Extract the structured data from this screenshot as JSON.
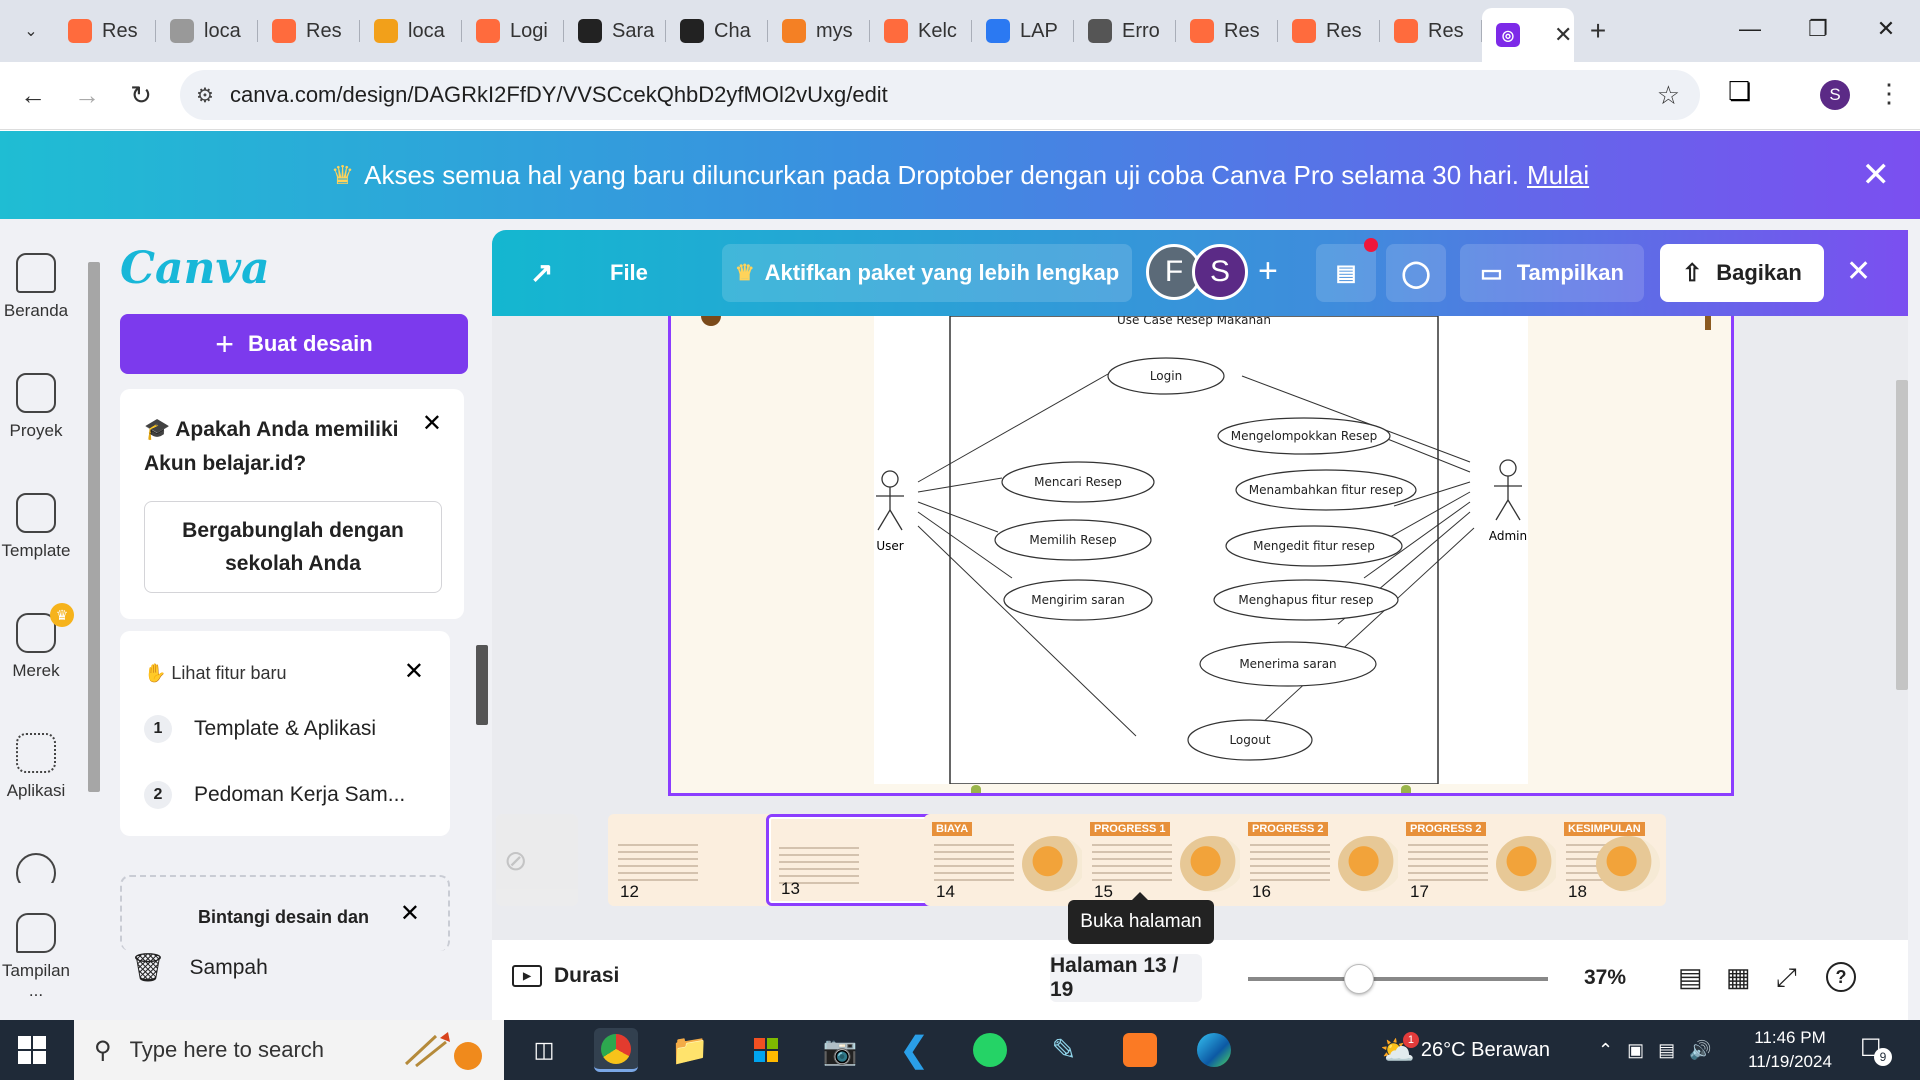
{
  "browser": {
    "tabs": [
      {
        "title": "Res",
        "icon": "canva-favicon",
        "color": "#ff6b3d"
      },
      {
        "title": "loca",
        "icon": "phpmyadmin-favicon",
        "color": "#999999"
      },
      {
        "title": "Res",
        "icon": "canva-favicon",
        "color": "#ff6b3d"
      },
      {
        "title": "loca",
        "icon": "pma-favicon",
        "color": "#f2a01a"
      },
      {
        "title": "Logi",
        "icon": "canva-favicon",
        "color": "#ff6b3d"
      },
      {
        "title": "Sara",
        "icon": "github-icon",
        "color": "#222222"
      },
      {
        "title": "Cha",
        "icon": "chatgpt-icon",
        "color": "#222222"
      },
      {
        "title": "mys",
        "icon": "stackoverflow-icon",
        "color": "#f48024"
      },
      {
        "title": "Kelc",
        "icon": "canva-favicon",
        "color": "#ff6b3d"
      },
      {
        "title": "LAP",
        "icon": "docs-icon",
        "color": "#2b79f2"
      },
      {
        "title": "Erro",
        "icon": "globe-icon",
        "color": "#555555"
      },
      {
        "title": "Res",
        "icon": "canva-favicon",
        "color": "#ff6b3d"
      },
      {
        "title": "Res",
        "icon": "canva-favicon",
        "color": "#ff6b3d"
      },
      {
        "title": "Res",
        "icon": "canva-favicon",
        "color": "#ff6b3d"
      }
    ],
    "url": "canva.com/design/DAGRkI2FfDY/VVSCcekQhbD2yfMOl2vUxg/edit",
    "profile_initial": "S"
  },
  "promo": {
    "text": "Akses semua hal yang baru diluncurkan pada Droptober dengan uji coba Canva Pro selama 30 hari.",
    "link": "Mulai"
  },
  "rail": {
    "items": [
      "Beranda",
      "Proyek",
      "Template",
      "Merek",
      "Aplikasi",
      "Tampilan ..."
    ]
  },
  "panel": {
    "logo": "Canva",
    "create_label": "Buat desain",
    "card1_title": "Apakah Anda memiliki Akun belajar.id?",
    "card1_button": "Bergabunglah dengan sekolah Anda",
    "card2_title": "Lihat fitur baru",
    "features": [
      {
        "num": "1",
        "label": "Template & Aplikasi"
      },
      {
        "num": "2",
        "label": "Pedoman Kerja Sam..."
      }
    ],
    "card3_title": "Bintangi desain dan",
    "trash_label": "Sampah"
  },
  "toolbar": {
    "file": "File",
    "upgrade": "Aktifkan paket yang lebih lengkap",
    "avatar1": "F",
    "avatar2": "S",
    "present": "Tampilkan",
    "share": "Bagikan"
  },
  "diagram": {
    "title": "Use Case Resep Makanan",
    "actor_user": "User",
    "actor_admin": "Admin",
    "usecases": [
      "Login",
      "Mengelompokkan Resep",
      "Mencari Resep",
      "Menambahkan fitur resep",
      "Memilih Resep",
      "Mengedit fitur resep",
      "Mengirim saran",
      "Menghapus fitur resep",
      "Menerima saran",
      "Logout"
    ]
  },
  "thumbnails": [
    {
      "num": "12",
      "title": ""
    },
    {
      "num": "13",
      "title": ""
    },
    {
      "num": "14",
      "title": "BIAYA"
    },
    {
      "num": "15",
      "title": "PROGRESS 1"
    },
    {
      "num": "16",
      "title": "PROGRESS 2"
    },
    {
      "num": "17",
      "title": "PROGRESS 2"
    },
    {
      "num": "18",
      "title": "KESIMPULAN"
    }
  ],
  "tooltip": "Buka halaman",
  "footer": {
    "durasi": "Durasi",
    "page_indicator": "Halaman 13 / 19",
    "zoom": "37%",
    "zoom_level": 0.37
  },
  "taskbar": {
    "search_placeholder": "Type here to search",
    "weather": "26°C  Berawan",
    "weather_badge": "1",
    "time": "11:46 PM",
    "date": "11/19/2024",
    "notif_count": "9"
  }
}
